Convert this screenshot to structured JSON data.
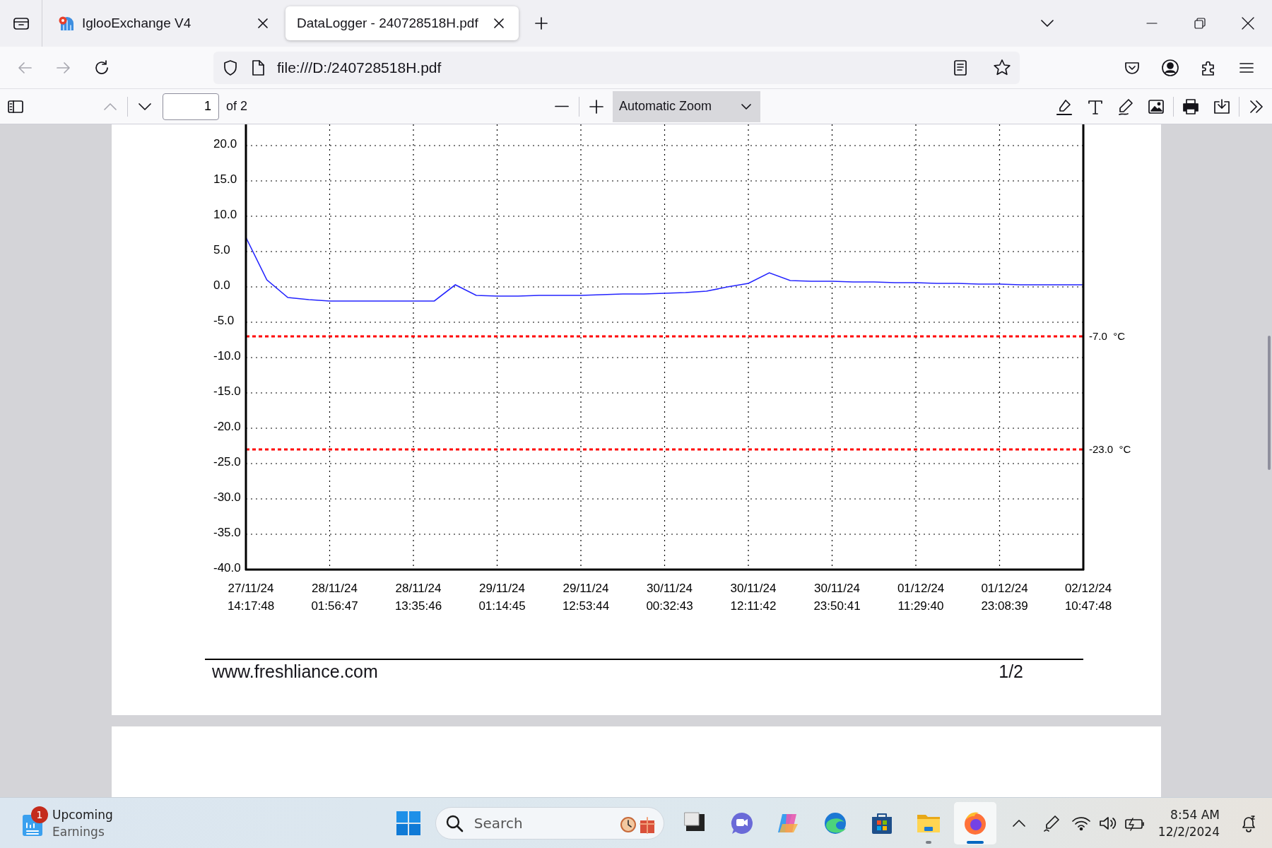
{
  "browser": {
    "tabs": [
      {
        "kind": "site",
        "title": "IglooExchange V4",
        "selected": false
      },
      {
        "kind": "document",
        "title": "DataLogger - 240728518H.pdf",
        "selected": true
      }
    ],
    "nav": {
      "back_disabled": true,
      "forward_disabled": true,
      "url": "file:///D:/240728518H.pdf"
    }
  },
  "pdf_toolbar": {
    "previous_disabled": true,
    "page": "1",
    "page_count": "of 2",
    "zoom": "Automatic Zoom"
  },
  "document": {
    "chart_data": {
      "type": "line",
      "categories": [
        "27/11/24 14:17:48",
        null,
        null,
        null,
        "28/11/24 01:56:47",
        null,
        null,
        null,
        "28/11/24 13:35:46",
        null,
        null,
        null,
        "29/11/24 01:14:45",
        null,
        null,
        null,
        "29/11/24 12:53:44",
        null,
        null,
        null,
        "30/11/24 00:32:43",
        null,
        null,
        null,
        "30/11/24 12:11:42",
        null,
        null,
        null,
        "30/11/24 23:50:41",
        null,
        null,
        null,
        "01/12/24 11:29:40",
        null,
        null,
        null,
        "01/12/24 23:08:39",
        null,
        null,
        null,
        "02/12/24 10:47:48"
      ],
      "series": [
        {
          "color": "#2424ff",
          "values": [
            7,
            1.0,
            -1.5,
            -1.8,
            -2,
            -2,
            -2,
            -2,
            -2,
            -2,
            0.3,
            -1.2,
            -1.3,
            -1.3,
            -1.2,
            -1.2,
            -1.2,
            -1.1,
            -1.0,
            -1.0,
            -0.9,
            -0.8,
            -0.6,
            0,
            0.5,
            2.0,
            0.9,
            0.8,
            0.8,
            0.7,
            0.7,
            0.6,
            0.6,
            0.5,
            0.5,
            0.4,
            0.4,
            0.3,
            0.3,
            0.3,
            0.3
          ]
        }
      ],
      "ylim": [
        -40,
        23
      ],
      "grid": true,
      "yticks": [
        {
          "value": 20,
          "label": "20.0"
        },
        {
          "value": 15,
          "label": "15.0"
        },
        {
          "value": 10,
          "label": "10.0"
        },
        {
          "value": 5,
          "label": "5.0"
        },
        {
          "value": 0,
          "label": "0.0"
        },
        {
          "value": -5,
          "label": "-5.0"
        },
        {
          "value": -10,
          "label": "-10.0"
        },
        {
          "value": -15,
          "label": "-15.0"
        },
        {
          "value": -20,
          "label": "-20.0"
        },
        {
          "value": -25,
          "label": "-25.0"
        },
        {
          "value": -30,
          "label": "-30.0"
        },
        {
          "value": -35,
          "label": "-35.0"
        },
        {
          "value": -40,
          "label": "-40.0"
        }
      ],
      "ref_lines": [
        {
          "axis": "y",
          "value": -7,
          "label": "-7.0 °C",
          "color": "#ff0000"
        },
        {
          "axis": "y",
          "value": -23,
          "label": "-23.0 °C",
          "color": "#ff0000"
        }
      ]
    },
    "footer": {
      "website": "www.freshliance.com",
      "page": "1/2"
    }
  },
  "taskbar": {
    "widget": {
      "title": "Upcoming",
      "subtitle": "Earnings",
      "badge": "1"
    },
    "search": {
      "placeholder": "Search"
    },
    "apps": [
      {
        "kind": "square",
        "running": false,
        "selected": false
      },
      {
        "kind": "chat",
        "running": false,
        "selected": false
      },
      {
        "kind": "ribbon",
        "running": false,
        "selected": false
      },
      {
        "kind": "wave",
        "running": false,
        "selected": false
      },
      {
        "kind": "store",
        "running": false,
        "selected": false
      },
      {
        "kind": "folder",
        "running": true,
        "selected": false
      },
      {
        "kind": "fox",
        "running": true,
        "selected": true
      }
    ],
    "clock": {
      "time": "8:54 AM",
      "date": "12/2/2024"
    }
  }
}
